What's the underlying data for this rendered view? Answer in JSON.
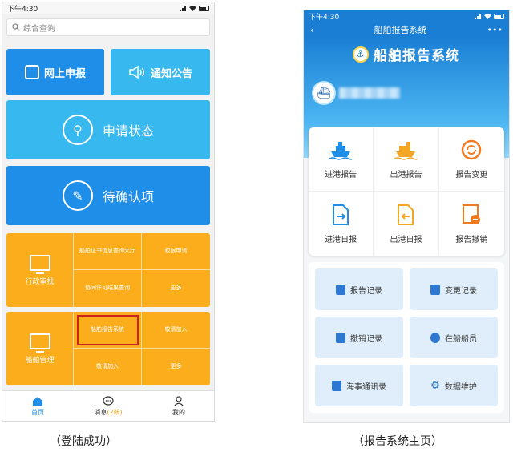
{
  "colors": {
    "primary_blue": "#1f8ee8",
    "light_blue": "#37b8ee",
    "orange": "#fbad1b",
    "header_blue": "#1a7fd4",
    "highlight_red": "#cc2222",
    "tile_light": "#dfeefa"
  },
  "left": {
    "statusbar_time": "下午4:30",
    "search_placeholder": "综合查询",
    "tile_online_apply": "网上申报",
    "tile_notice": "通知公告",
    "tile_apply_status": "申请状态",
    "tile_pending": "待确认项",
    "cat_admin": "行政审批",
    "cat_ship": "船舶管理",
    "admin_cell_1": "船舶证书信息查询大厅",
    "admin_cell_2": "权限申请",
    "admin_cell_3": "协同许可结果查询",
    "admin_cell_4": "更多",
    "ship_cell_1": "船舶报告系统",
    "ship_cell_2": "敬请加入",
    "ship_cell_3": "敬请加入",
    "ship_cell_4": "更多",
    "nav_home": "首页",
    "nav_messages": "消息",
    "nav_messages_badge": "(2新)",
    "nav_mine": "我的"
  },
  "right": {
    "statusbar_time": "下午4:30",
    "title": "船舶报告系统",
    "brand": "船舶报告系统",
    "grid": [
      {
        "label": "进港报告",
        "icon": "ship-in-icon",
        "color": "#1f8ee8"
      },
      {
        "label": "出港报告",
        "icon": "ship-out-icon",
        "color": "#f5a623"
      },
      {
        "label": "报告变更",
        "icon": "refresh-icon",
        "color": "#f07a22"
      },
      {
        "label": "进港日报",
        "icon": "doc-in-icon",
        "color": "#1f8ee8"
      },
      {
        "label": "出港日报",
        "icon": "doc-out-icon",
        "color": "#f5a623"
      },
      {
        "label": "报告撤销",
        "icon": "doc-cancel-icon",
        "color": "#f07a22"
      }
    ],
    "list": [
      {
        "label": "报告记录",
        "icon": "record-icon"
      },
      {
        "label": "变更记录",
        "icon": "change-record-icon"
      },
      {
        "label": "撤销记录",
        "icon": "cancel-record-icon"
      },
      {
        "label": "在船船员",
        "icon": "crew-icon"
      },
      {
        "label": "海事通讯录",
        "icon": "contacts-icon"
      },
      {
        "label": "数据维护",
        "icon": "gear-icon"
      }
    ]
  },
  "captions": {
    "left": "（登陆成功）",
    "right": "（报告系统主页）"
  }
}
